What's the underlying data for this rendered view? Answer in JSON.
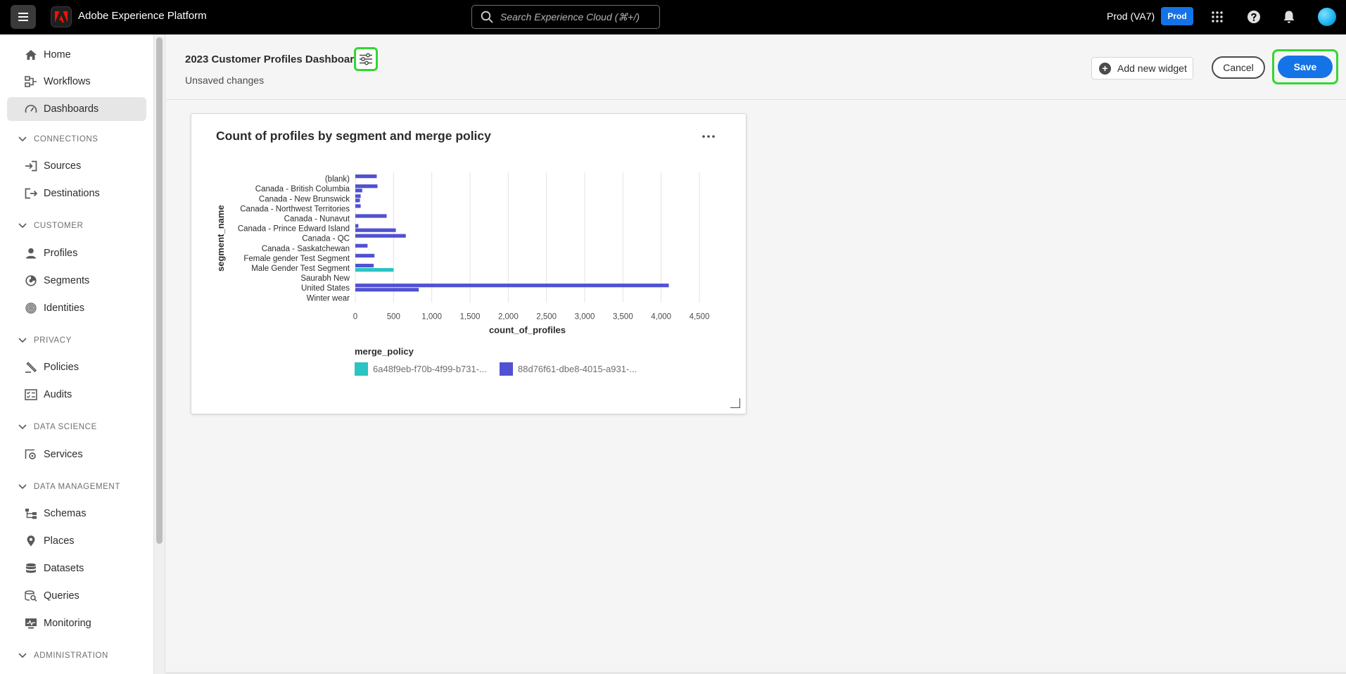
{
  "topbar": {
    "app_title": "Adobe Experience Platform",
    "search_placeholder": "Search Experience Cloud (⌘+/)",
    "env_label": "Prod (VA7)",
    "env_badge": "Prod",
    "icons": [
      "apps-grid-icon",
      "help-icon",
      "notifications-bell-icon",
      "user-avatar"
    ]
  },
  "sidebar": {
    "items": [
      {
        "label": "Home",
        "icon": "home-icon"
      },
      {
        "label": "Workflows",
        "icon": "workflows-icon"
      },
      {
        "label": "Dashboards",
        "icon": "dashboard-gauge-icon",
        "active": true
      }
    ],
    "sections": [
      {
        "title": "CONNECTIONS",
        "items": [
          {
            "label": "Sources",
            "icon": "sources-icon"
          },
          {
            "label": "Destinations",
            "icon": "destinations-icon"
          }
        ]
      },
      {
        "title": "CUSTOMER",
        "items": [
          {
            "label": "Profiles",
            "icon": "profile-icon"
          },
          {
            "label": "Segments",
            "icon": "segments-icon"
          },
          {
            "label": "Identities",
            "icon": "fingerprint-icon"
          }
        ]
      },
      {
        "title": "PRIVACY",
        "items": [
          {
            "label": "Policies",
            "icon": "policies-icon"
          },
          {
            "label": "Audits",
            "icon": "audits-icon"
          }
        ]
      },
      {
        "title": "DATA SCIENCE",
        "items": [
          {
            "label": "Services",
            "icon": "services-icon"
          }
        ]
      },
      {
        "title": "DATA MANAGEMENT",
        "items": [
          {
            "label": "Schemas",
            "icon": "schemas-icon"
          },
          {
            "label": "Places",
            "icon": "location-pin-icon"
          },
          {
            "label": "Datasets",
            "icon": "datasets-icon"
          },
          {
            "label": "Queries",
            "icon": "queries-icon"
          },
          {
            "label": "Monitoring",
            "icon": "monitoring-icon"
          }
        ]
      },
      {
        "title": "ADMINISTRATION",
        "items": []
      }
    ]
  },
  "header": {
    "title": "2023 Customer Profiles Dashboard",
    "status": "Unsaved changes",
    "add_widget_label": "Add new widget",
    "cancel_label": "Cancel",
    "save_label": "Save"
  },
  "widget": {
    "title": "Count of profiles by segment and merge policy",
    "legend_title": "merge_policy"
  },
  "chart_data": {
    "type": "bar",
    "orientation": "horizontal",
    "title": "Count of profiles by segment and merge policy",
    "xlabel": "count_of_profiles",
    "ylabel": "segment_name",
    "xlim": [
      0,
      4500
    ],
    "xticks": [
      0,
      500,
      1000,
      1500,
      2000,
      2500,
      3000,
      3500,
      4000,
      4500
    ],
    "xtick_labels": [
      "0",
      "500",
      "1,000",
      "1,500",
      "2,000",
      "2,500",
      "3,000",
      "3,500",
      "4,000",
      "4,500"
    ],
    "grid": "vertical",
    "legend": "bottom-left",
    "categories": [
      "(blank)",
      "Canada - British Columbia",
      "Canada - New Brunswick",
      "Canada - Northwest Territories",
      "Canada - Nunavut",
      "Canada - Prince Edward Island",
      "Canada - QC",
      "Canada - Saskatchewan",
      "Female gender Test Segment",
      "Male Gender Test Segment",
      "Saurabh New",
      "United States",
      "Winter wear"
    ],
    "bars": [
      {
        "category": 0,
        "series": 1,
        "value": 280
      },
      {
        "category": 1,
        "series": 1,
        "value": 290
      },
      {
        "category": 1,
        "series": 1,
        "value": 90
      },
      {
        "category": 2,
        "series": 1,
        "value": 70
      },
      {
        "category": 2,
        "series": 1,
        "value": 60
      },
      {
        "category": 3,
        "series": 1,
        "value": 70
      },
      {
        "category": 4,
        "series": 1,
        "value": 410
      },
      {
        "category": 5,
        "series": 1,
        "value": 40
      },
      {
        "category": 5,
        "series": 1,
        "value": 530
      },
      {
        "category": 6,
        "series": 1,
        "value": 660
      },
      {
        "category": 7,
        "series": 1,
        "value": 160
      },
      {
        "category": 8,
        "series": 1,
        "value": 250
      },
      {
        "category": 9,
        "series": 1,
        "value": 240
      },
      {
        "category": 9,
        "series": 0,
        "value": 500
      },
      {
        "category": 11,
        "series": 1,
        "value": 4100
      },
      {
        "category": 11,
        "series": 1,
        "value": 830
      }
    ],
    "series": [
      {
        "name": "6a48f9eb-f70b-4f99-b731-...",
        "color": "#2bc3c3"
      },
      {
        "name": "88d76f61-dbe8-4015-a931-...",
        "color": "#5151d3"
      }
    ]
  },
  "colors": {
    "accent": "#1473e6",
    "highlight": "#33d633"
  }
}
